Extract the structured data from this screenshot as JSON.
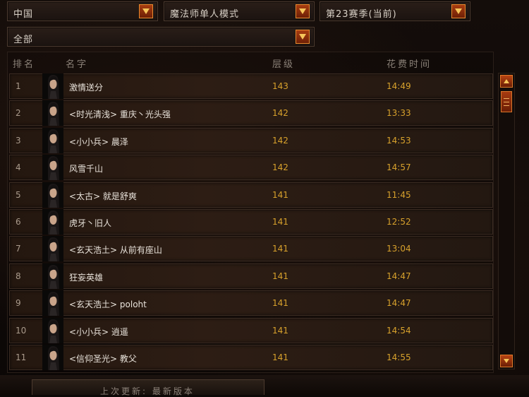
{
  "filters": {
    "region": "中国",
    "mode": "魔法师单人模式",
    "season": "第23赛季(当前)",
    "category": "全部"
  },
  "columns": {
    "rank": "排名",
    "name": "名字",
    "level": "层级",
    "time": "花费时间"
  },
  "rows": [
    {
      "rank": "1",
      "name": "激情送分",
      "level": "143",
      "time": "14:49"
    },
    {
      "rank": "2",
      "name": "<时光清浅> 重庆丶光头强",
      "level": "142",
      "time": "13:33"
    },
    {
      "rank": "3",
      "name": "<小小兵> 晨泽",
      "level": "142",
      "time": "14:53"
    },
    {
      "rank": "4",
      "name": "风雪千山",
      "level": "142",
      "time": "14:57"
    },
    {
      "rank": "5",
      "name": "<太古> 就是舒爽",
      "level": "141",
      "time": "11:45"
    },
    {
      "rank": "6",
      "name": "虎牙丶旧人",
      "level": "141",
      "time": "12:52"
    },
    {
      "rank": "7",
      "name": "<玄天浩土> 从前有座山",
      "level": "141",
      "time": "13:04"
    },
    {
      "rank": "8",
      "name": "狂妄英雄",
      "level": "141",
      "time": "14:47"
    },
    {
      "rank": "9",
      "name": "<玄天浩土> poloht",
      "level": "141",
      "time": "14:47"
    },
    {
      "rank": "10",
      "name": "<小小兵> 逍遥",
      "level": "141",
      "time": "14:54"
    },
    {
      "rank": "11",
      "name": "<信仰圣光> 教父",
      "level": "141",
      "time": "14:55"
    }
  ],
  "footer": {
    "last_updated": "上次更新: 最新版本"
  },
  "icons": {
    "dropdown": "chevron-down-icon",
    "scroll_up": "arrow-up-icon",
    "scroll_down": "arrow-down-icon",
    "avatar": "wizard-portrait-icon"
  },
  "colors": {
    "accent": "#d7a12c",
    "button": "#a83d10",
    "text": "#e8e2da"
  }
}
